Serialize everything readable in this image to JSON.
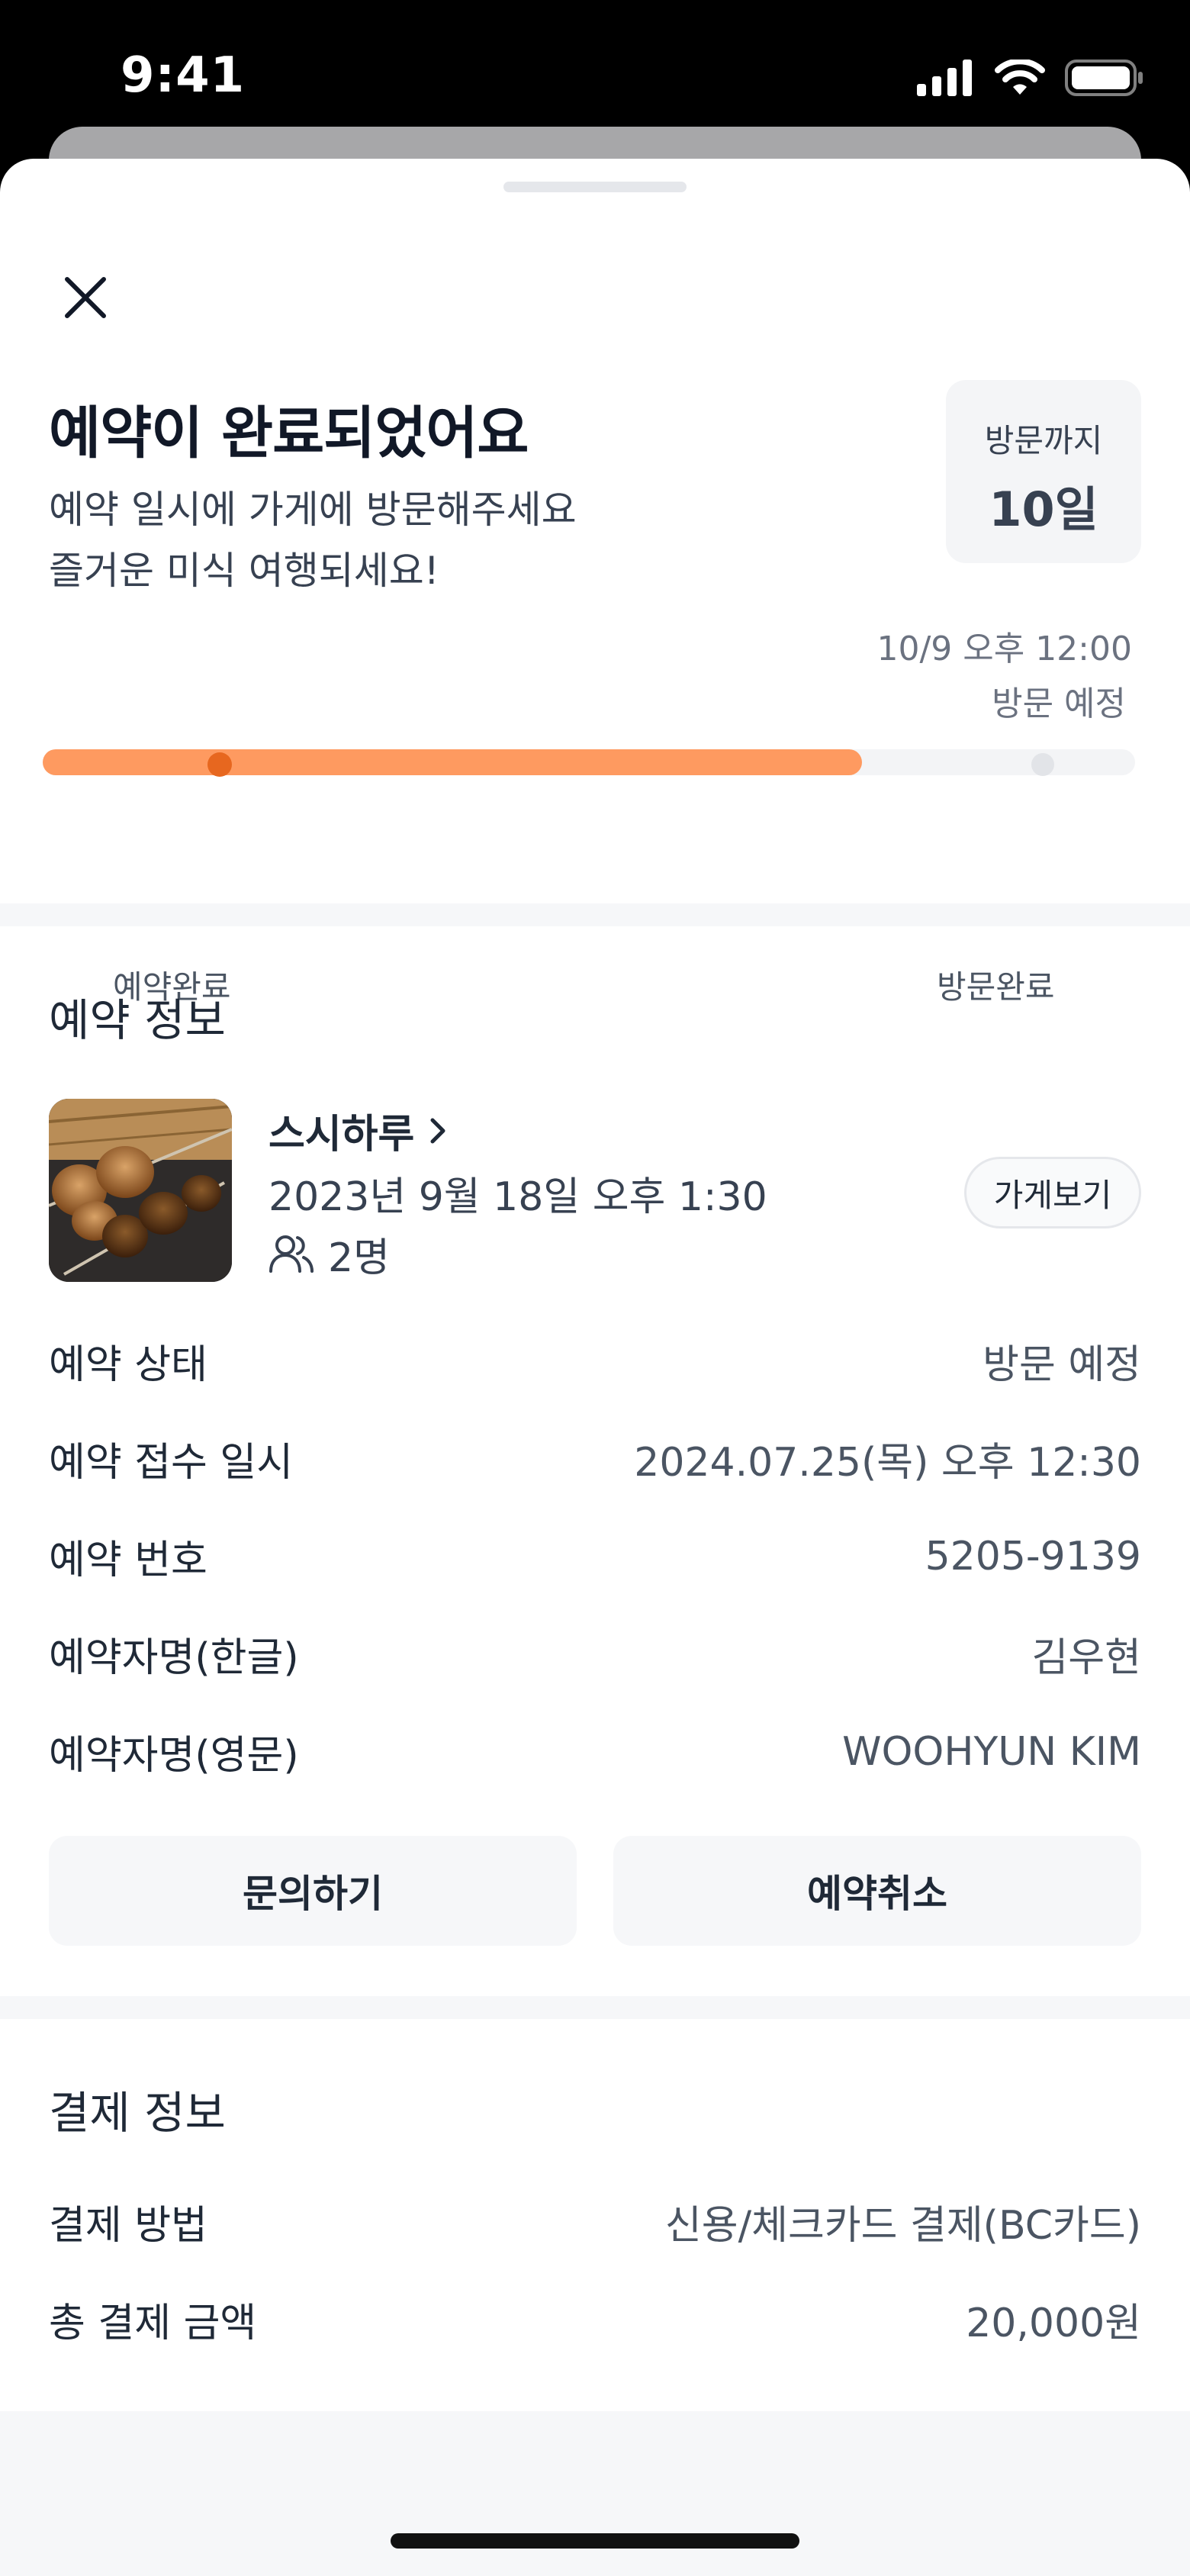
{
  "status_bar": {
    "time": "9:41"
  },
  "header": {
    "title": "예약이 완료되었어요",
    "subtitle_line1": "예약 일시에 가게에 방문해주세요",
    "subtitle_line2": "즐거운 미식 여행되세요!",
    "dday_label": "방문까지",
    "dday_value": "10일",
    "visit_time": "10/9 오후 12:00",
    "visit_status": "방문 예정",
    "progress": 0.75,
    "step_start": "예약완료",
    "step_end": "방문완료",
    "colors": {
      "progress": "#fe9a60",
      "progress_dot": "#e7671f"
    }
  },
  "reservation": {
    "section_title": "예약 정보",
    "store_name": "스시하루",
    "datetime": "2023년 9월 18일 오후 1:30",
    "people": "2명",
    "store_button": "가게보기",
    "rows": [
      {
        "label": "예약 상태",
        "value": "방문 예정"
      },
      {
        "label": "예약 접수 일시",
        "value": "2024.07.25(목) 오후 12:30"
      },
      {
        "label": "예약 번호",
        "value": "5205-9139"
      },
      {
        "label": "예약자명(한글)",
        "value": "김우현"
      },
      {
        "label": "예약자명(영문)",
        "value": "WOOHYUN KIM"
      }
    ],
    "inquiry_button": "문의하기",
    "cancel_button": "예약취소"
  },
  "payment": {
    "section_title": "결제 정보",
    "rows": [
      {
        "label": "결제 방법",
        "value": "신용/체크카드 결제(BC카드)"
      },
      {
        "label": "총 결제 금액",
        "value": "20,000원"
      }
    ]
  },
  "icons": [
    "close-icon",
    "chevron-right-icon",
    "people-icon",
    "signal-icon",
    "wifi-icon",
    "battery-icon"
  ]
}
